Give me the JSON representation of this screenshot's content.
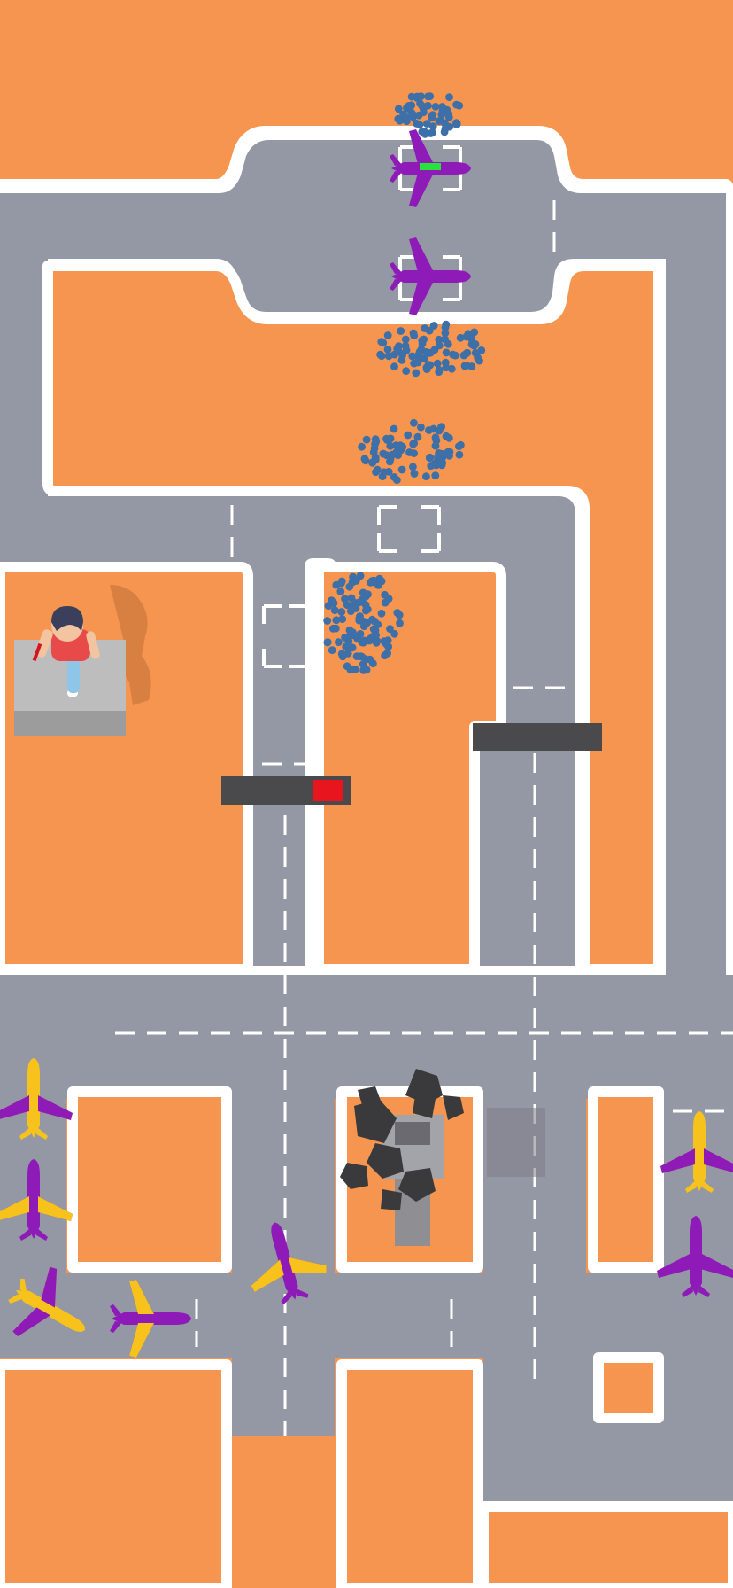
{
  "game": {
    "title": "",
    "colors": {
      "ground": "#F6954F",
      "asphalt": "#9498A4",
      "border": "#FFFFFF",
      "lane_marking": "#FFFFFF",
      "gate_bar": "#4A4A4C",
      "gate_red_light": "#E8141E",
      "boarding_progress": "#27E23C",
      "plane_purple": "#8E1BB8",
      "plane_yellow": "#F7C21C",
      "passenger": "#3D6FA8",
      "smoke": "#3A3A3C",
      "tower": "#8E8E93"
    },
    "stands_top": [
      {
        "id": "stand-1",
        "plane": "purple",
        "boarding_progress": 0.8,
        "occupied": true
      },
      {
        "id": "stand-2",
        "plane": "purple",
        "occupied": true
      },
      {
        "id": "stand-3",
        "occupied": false
      },
      {
        "id": "stand-4",
        "occupied": false
      }
    ],
    "passenger_crowds": 4,
    "gates": [
      {
        "id": "gate-left",
        "state": "closed",
        "light": "red"
      },
      {
        "id": "gate-right",
        "state": "closed",
        "light": "none"
      }
    ],
    "parked_planes_left": [
      {
        "color": "yellow-purple"
      },
      {
        "color": "purple-yellow"
      },
      {
        "color": "yellow-purple"
      },
      {
        "color": "purple-yellow"
      }
    ],
    "taxiing_plane": {
      "color": "purple-yellow"
    },
    "parked_planes_right": [
      {
        "color": "yellow-purple"
      },
      {
        "color": "purple"
      }
    ],
    "control_tower": {
      "state": "destroyed",
      "smoke": true
    },
    "player": {
      "character": "ground-controller",
      "platform": "grey-block"
    }
  }
}
